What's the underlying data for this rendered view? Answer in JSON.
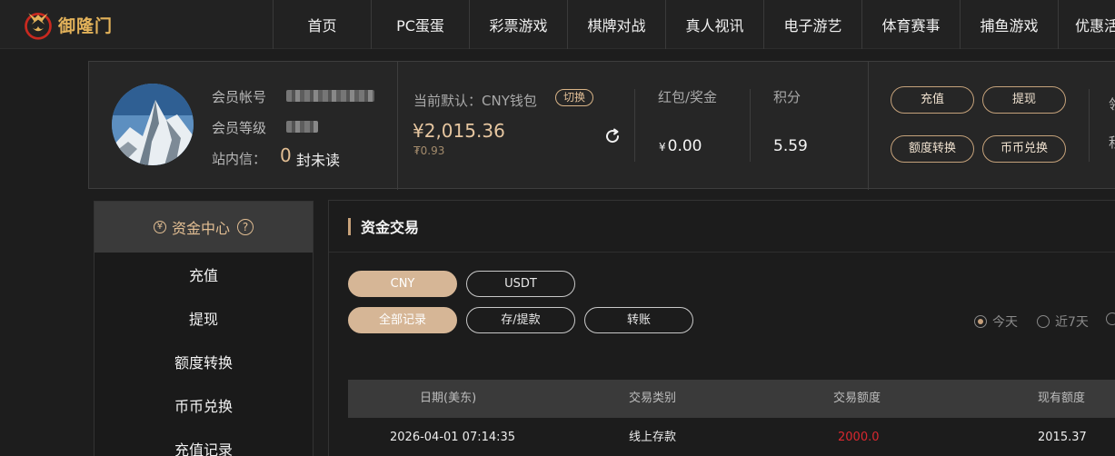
{
  "header": {
    "logo_text": "御隆门",
    "nav": [
      "首页",
      "PC蛋蛋",
      "彩票游戏",
      "棋牌对战",
      "真人视讯",
      "电子游艺",
      "体育赛事",
      "捕鱼游戏",
      "优惠活"
    ]
  },
  "member": {
    "account_label": "会员帐号",
    "level_label": "会员等级",
    "message_label": "站内信：",
    "message_count": "0",
    "message_suffix": "封未读"
  },
  "wallet": {
    "default_label": "当前默认：CNY钱包",
    "switch_label": "切换",
    "balance": "¥2,015.36",
    "balance_sub": "₮0.93",
    "redpacket_label": "红包/奖金",
    "redpacket_currency": "¥",
    "redpacket_value": "0.00",
    "points_label": "积分",
    "points_value": "5.59"
  },
  "actions": {
    "deposit": "充值",
    "withdraw": "提现",
    "quota_transfer": "额度转换",
    "coin_exchange": "币币兑换",
    "edge_top": "领",
    "edge_bottom": "积"
  },
  "sidebar": {
    "title": "资金中心",
    "title_icon": "yen-circle-icon",
    "help": "?",
    "items": [
      "充值",
      "提现",
      "额度转换",
      "币币兑换",
      "充值记录"
    ]
  },
  "main": {
    "title": "资金交易",
    "currency_tabs": [
      "CNY",
      "USDT"
    ],
    "type_tabs": [
      "全部记录",
      "存/提款",
      "转账"
    ],
    "range_options": [
      "今天",
      "近7天"
    ],
    "table": {
      "headers": [
        "日期(美东)",
        "交易类别",
        "交易额度",
        "现有额度"
      ],
      "rows": [
        [
          "2026-04-01 07:14:35",
          "线上存款",
          "2000.0",
          "2015.37"
        ]
      ]
    }
  },
  "colors": {
    "accent": "#d6b696",
    "gold_text": "#e2be93",
    "amount_red": "#d9282f"
  }
}
